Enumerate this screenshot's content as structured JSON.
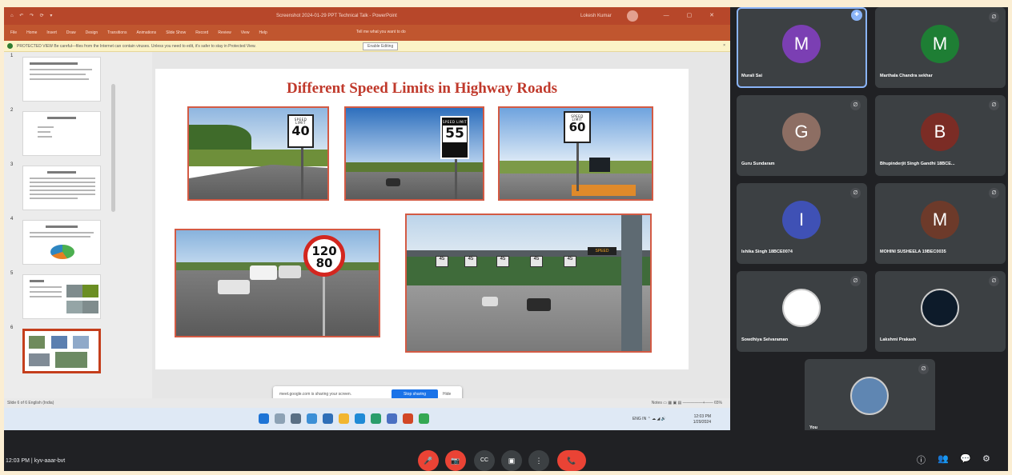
{
  "ppt": {
    "title_bar": {
      "quick_access": "⌂ ↶ ↷ ⟳ ▾",
      "document": "Screenshot 2024-01-29 PPT Technical Talk - PowerPoint",
      "account": "Lokesh Kumar",
      "window_controls": "— ▢ ✕"
    },
    "ribbon_tabs": [
      "File",
      "Home",
      "Insert",
      "Draw",
      "Design",
      "Transitions",
      "Animations",
      "Slide Show",
      "Record",
      "Review",
      "View",
      "Help"
    ],
    "ribbon_search": "Tell me what you want to do",
    "protected_view": {
      "message": "PROTECTED VIEW  Be careful—files from the Internet can contain viruses. Unless you need to edit, it's safer to stay in Protected View.",
      "button": "Enable Editing",
      "close": "×"
    },
    "thumbnails": [
      {
        "num": "1"
      },
      {
        "num": "2"
      },
      {
        "num": "3"
      },
      {
        "num": "4"
      },
      {
        "num": "5"
      },
      {
        "num": "6"
      }
    ],
    "slide_title": "Different Speed Limits in Highway Roads",
    "signs": {
      "speed_limit_label": "SPEED LIMIT",
      "s1": "40",
      "s2": "55",
      "s3": "60",
      "round_top": "120",
      "round_bottom": "80"
    },
    "share_notice": {
      "text": "meet.google.com is sharing your screen.",
      "stop": "Stop sharing",
      "hide": "Hide"
    },
    "status_left": "Slide 6 of 6   English (India)",
    "status_right": "Notes   ▭  ▦  ▣  ▤   —————+——  65%",
    "tray": "ENG IN   ⌃ ☁ ◢ 🔊",
    "clock_time": "12:03 PM",
    "clock_date": "1/29/2024"
  },
  "participants": [
    {
      "initial": "M",
      "name": "Murali Sai",
      "color": "#7b3fb3",
      "pinned": true
    },
    {
      "initial": "M",
      "name": "Marthala Chandra sekhar",
      "color": "#1e7e34"
    },
    {
      "initial": "G",
      "name": "Guru Sundaram",
      "color": "#8d6e63"
    },
    {
      "initial": "B",
      "name": "Bhupinderjit Singh Gandhi 18BCE...",
      "color": "#7b2c25"
    },
    {
      "initial": "I",
      "name": "Ishika Singh 18BCE0074",
      "color": "#3f51b5"
    },
    {
      "initial": "M",
      "name": "MOHINI SUSHEELA 19BEC0035",
      "color": "#6d3a2a"
    },
    {
      "initial": "",
      "name": "Sowdhiya Selvaraman",
      "color": "#ffffff"
    },
    {
      "initial": "",
      "name": "Lakshmi Prakash",
      "color": "#0d1b2a"
    },
    {
      "initial": "",
      "name": "You",
      "color": "#5f86b2"
    }
  ],
  "meeting": {
    "time": "12:03 PM",
    "separator": "|",
    "code": "kyv-aaar-bvt"
  },
  "controls": {
    "mic": "🎤",
    "camera": "📷",
    "captions": "CC",
    "present": "▣",
    "more": "⋮",
    "hangup": "📞"
  },
  "right_controls": {
    "info": "ⓘ",
    "people": "👥",
    "chat": "💬",
    "activities": "⚙"
  },
  "colors": {
    "ppt_accent": "#b7472a",
    "slide_title": "#c0392b",
    "meet_bg": "#202124",
    "hangup": "#ea4335",
    "stop_share": "#1a73e8"
  }
}
